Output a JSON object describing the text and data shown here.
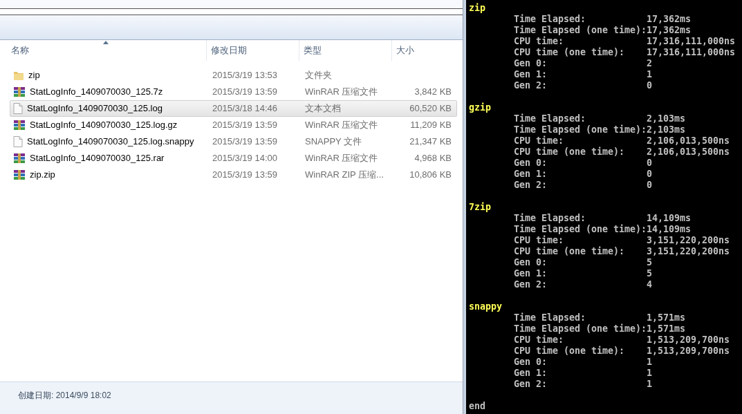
{
  "explorer": {
    "columns": [
      {
        "label": "名称",
        "sorted": true
      },
      {
        "label": "修改日期",
        "sorted": false
      },
      {
        "label": "类型",
        "sorted": false
      },
      {
        "label": "大小",
        "sorted": false
      }
    ],
    "files": [
      {
        "kind": "folder",
        "name": "zip",
        "modified": "2015/3/19 13:53",
        "type": "文件夹",
        "selected": false
      },
      {
        "kind": "archive",
        "name": "StatLogInfo_1409070030_125.7z",
        "modified": "2015/3/19 13:59",
        "type": "WinRAR 压缩文件",
        "size": "3,842 KB",
        "selected": false
      },
      {
        "kind": "document",
        "name": "StatLogInfo_1409070030_125.log",
        "modified": "2015/3/18 14:46",
        "type": "文本文档",
        "size": "60,520 KB",
        "selected": true
      },
      {
        "kind": "archive",
        "name": "StatLogInfo_1409070030_125.log.gz",
        "modified": "2015/3/19 13:59",
        "type": "WinRAR 压缩文件",
        "size": "11,209 KB",
        "selected": false
      },
      {
        "kind": "document",
        "name": "StatLogInfo_1409070030_125.log.snappy",
        "modified": "2015/3/19 13:59",
        "type": "SNAPPY 文件",
        "size": "21,347 KB",
        "selected": false
      },
      {
        "kind": "archive",
        "name": "StatLogInfo_1409070030_125.rar",
        "modified": "2015/3/19 14:00",
        "type": "WinRAR 压缩文件",
        "size": "4,968 KB",
        "selected": false
      },
      {
        "kind": "archive",
        "name": "zip.zip",
        "modified": "2015/3/19 13:59",
        "type": "WinRAR ZIP 压缩...",
        "size": "10,806 KB",
        "selected": false
      }
    ],
    "status_bar": "创建日期: 2014/9/9 18:02"
  },
  "console": {
    "sections": [
      {
        "title": "zip",
        "lines": [
          {
            "label": "Time Elapsed:",
            "value": "17,362ms"
          },
          {
            "label": "Time Elapsed (one time):",
            "value": "17,362ms"
          },
          {
            "label": "CPU time:",
            "value": "17,316,111,000ns"
          },
          {
            "label": "CPU time (one time):",
            "value": "17,316,111,000ns"
          },
          {
            "label": "Gen 0:",
            "value": "2"
          },
          {
            "label": "Gen 1:",
            "value": "1"
          },
          {
            "label": "Gen 2:",
            "value": "0"
          }
        ]
      },
      {
        "title": "gzip",
        "lines": [
          {
            "label": "Time Elapsed:",
            "value": "2,103ms"
          },
          {
            "label": "Time Elapsed (one time):",
            "value": "2,103ms"
          },
          {
            "label": "CPU time:",
            "value": "2,106,013,500ns"
          },
          {
            "label": "CPU time (one time):",
            "value": "2,106,013,500ns"
          },
          {
            "label": "Gen 0:",
            "value": "0"
          },
          {
            "label": "Gen 1:",
            "value": "0"
          },
          {
            "label": "Gen 2:",
            "value": "0"
          }
        ]
      },
      {
        "title": "7zip",
        "lines": [
          {
            "label": "Time Elapsed:",
            "value": "14,109ms"
          },
          {
            "label": "Time Elapsed (one time):",
            "value": "14,109ms"
          },
          {
            "label": "CPU time:",
            "value": "3,151,220,200ns"
          },
          {
            "label": "CPU time (one time):",
            "value": "3,151,220,200ns"
          },
          {
            "label": "Gen 0:",
            "value": "5"
          },
          {
            "label": "Gen 1:",
            "value": "5"
          },
          {
            "label": "Gen 2:",
            "value": "4"
          }
        ]
      },
      {
        "title": "snappy",
        "lines": [
          {
            "label": "Time Elapsed:",
            "value": "1,571ms"
          },
          {
            "label": "Time Elapsed (one time):",
            "value": "1,571ms"
          },
          {
            "label": "CPU time:",
            "value": "1,513,209,700ns"
          },
          {
            "label": "CPU time (one time):",
            "value": "1,513,209,700ns"
          },
          {
            "label": "Gen 0:",
            "value": "1"
          },
          {
            "label": "Gen 1:",
            "value": "1"
          },
          {
            "label": "Gen 2:",
            "value": "1"
          }
        ]
      }
    ],
    "footer": "end"
  }
}
